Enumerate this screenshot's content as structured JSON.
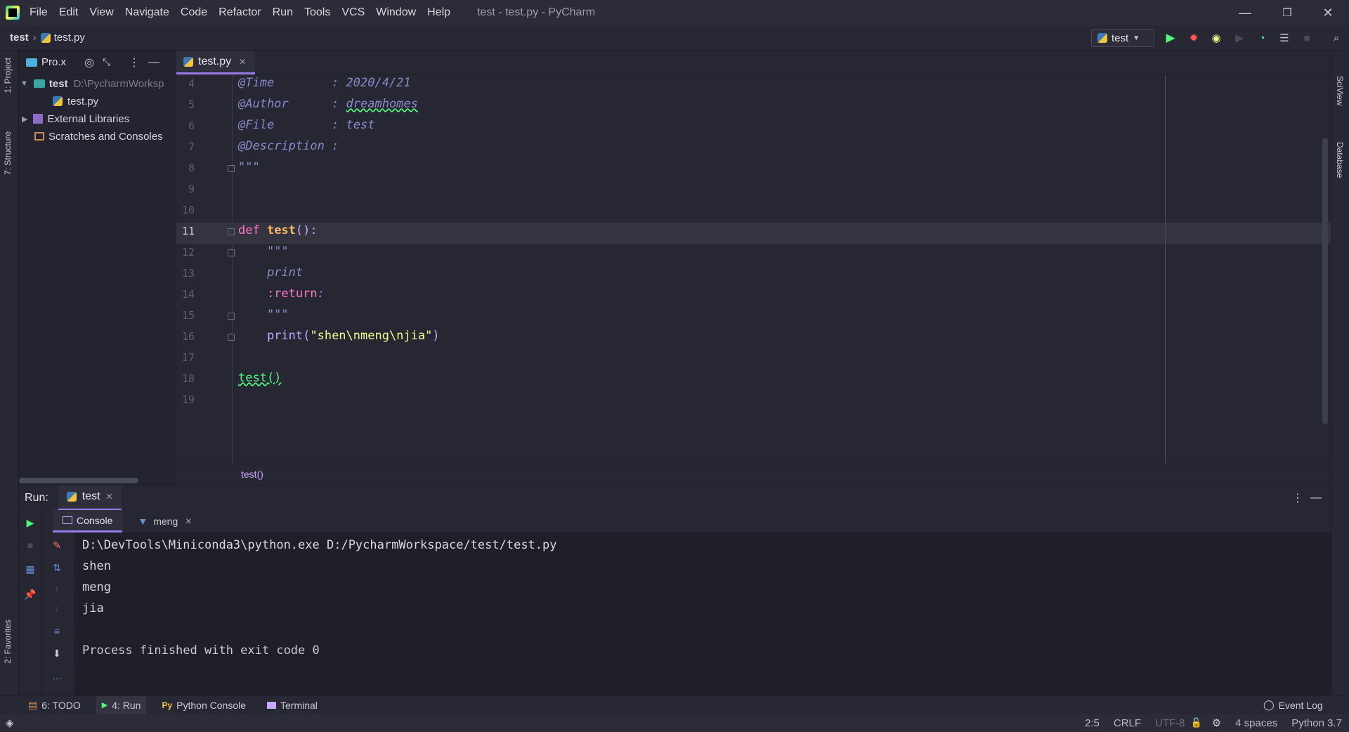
{
  "window": {
    "title": "test - test.py - PyCharm",
    "menu": [
      "File",
      "Edit",
      "View",
      "Navigate",
      "Code",
      "Refactor",
      "Run",
      "Tools",
      "VCS",
      "Window",
      "Help"
    ],
    "minimize": "—",
    "maximize": "❐",
    "close": "✕"
  },
  "navbar": {
    "project": "test",
    "separator": "›",
    "file": "test.py",
    "run_config": "test"
  },
  "left_strip": {
    "project_tab": "1: Project",
    "structure_tab": "7: Structure",
    "favorites_tab": "2: Favorites"
  },
  "right_strip": {
    "sciview_tab": "SciView",
    "database_tab": "Database"
  },
  "project_panel": {
    "title": "Pro.x",
    "root_name": "test",
    "root_path": "D:\\PycharmWorksp",
    "file": "test.py",
    "external": "External Libraries",
    "scratches": "Scratches and Consoles"
  },
  "editor": {
    "tab_label": "test.py",
    "breadcrumb": "test()",
    "lines": [
      {
        "num": "4",
        "parts": [
          {
            "t": "@Time        : 2020/4/21",
            "c": "cm"
          }
        ]
      },
      {
        "num": "5",
        "parts": [
          {
            "t": "@Author      : ",
            "c": "cm"
          },
          {
            "t": "dreamhomes",
            "c": "cm"
          }
        ]
      },
      {
        "num": "6",
        "parts": [
          {
            "t": "@File        : test",
            "c": "cm"
          }
        ]
      },
      {
        "num": "7",
        "parts": [
          {
            "t": "@Description :",
            "c": "cm"
          }
        ]
      },
      {
        "num": "8",
        "parts": [
          {
            "t": "\"\"\"",
            "c": "cm"
          }
        ]
      },
      {
        "num": "9",
        "parts": []
      },
      {
        "num": "10",
        "parts": []
      },
      {
        "num": "11",
        "parts": [
          {
            "t": "def ",
            "c": "kw"
          },
          {
            "t": "test",
            "c": "fn"
          },
          {
            "t": "():",
            "c": "plain"
          }
        ]
      },
      {
        "num": "12",
        "parts": [
          {
            "t": "    \"\"\"",
            "c": "cm"
          }
        ]
      },
      {
        "num": "13",
        "parts": [
          {
            "t": "    print",
            "c": "cm"
          }
        ]
      },
      {
        "num": "14",
        "parts": [
          {
            "t": "    :return",
            "c": "kw"
          },
          {
            "t": ":",
            "c": "cm"
          }
        ]
      },
      {
        "num": "15",
        "parts": [
          {
            "t": "    \"\"\"",
            "c": "cm"
          }
        ]
      },
      {
        "num": "16",
        "parts": [
          {
            "t": "    print(",
            "c": "plain"
          },
          {
            "t": "\"shen\\nmeng\\njia\"",
            "c": "str"
          },
          {
            "t": ")",
            "c": "plain"
          }
        ]
      },
      {
        "num": "17",
        "parts": []
      },
      {
        "num": "18",
        "parts": [
          {
            "t": "test()",
            "c": "green"
          }
        ]
      },
      {
        "num": "19",
        "parts": []
      }
    ]
  },
  "run_panel": {
    "label": "Run:",
    "tab": "test",
    "console_tab": "Console",
    "filter_tab": "meng",
    "output": [
      "D:\\DevTools\\Miniconda3\\python.exe D:/PycharmWorkspace/test/test.py",
      "shen",
      "meng",
      "jia",
      "",
      "Process finished with exit code 0"
    ]
  },
  "bottom_tools": {
    "todo": "6: TODO",
    "run": "4: Run",
    "python_console": "Python Console",
    "terminal": "Terminal",
    "event_log": "Event Log"
  },
  "status": {
    "position": "2:5",
    "line_sep": "CRLF",
    "encoding": "UTF-8",
    "indent": "4 spaces",
    "interpreter": "Python 3.7"
  },
  "colors": {
    "accent": "#9a7ae8",
    "run_green": "#50fa7b",
    "debug_red": "#ff5555"
  }
}
